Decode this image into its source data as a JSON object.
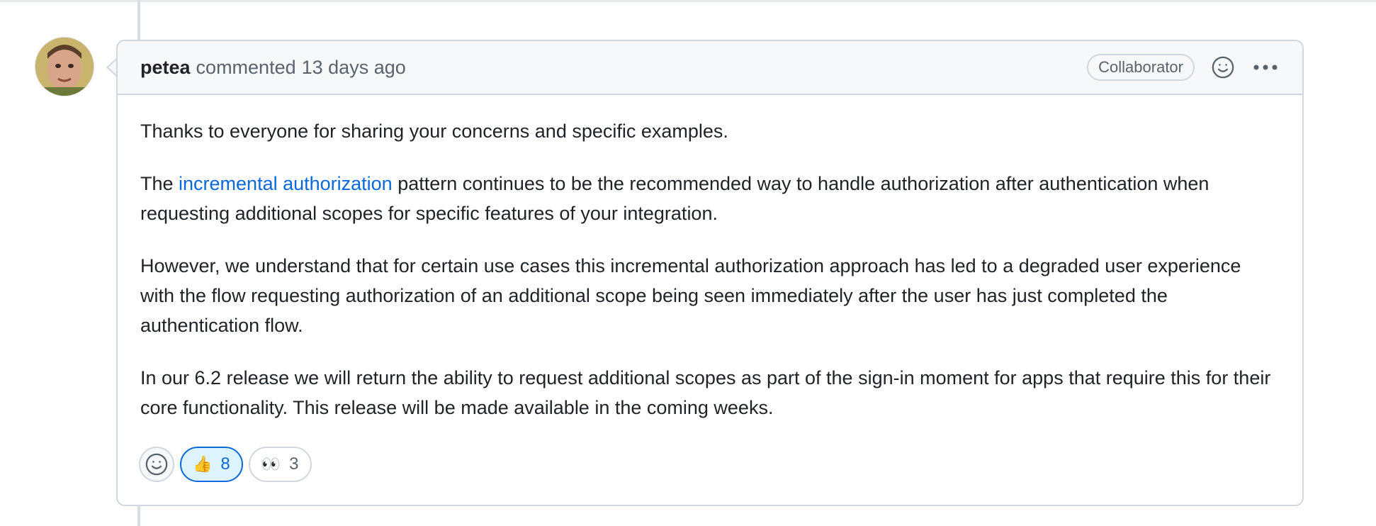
{
  "comment": {
    "author": "petea",
    "action": "commented",
    "timestamp": "13 days ago",
    "role_badge": "Collaborator",
    "paragraphs": {
      "p1": "Thanks to everyone for sharing your concerns and specific examples.",
      "p2_before": "The ",
      "p2_link": "incremental authorization",
      "p2_after": " pattern continues to be the recommended way to handle authorization after authentication when requesting additional scopes for specific features of your integration.",
      "p3": "However, we understand that for certain use cases this incremental authorization approach has led to a degraded user experience with the flow requesting authorization of an additional scope being seen immediately after the user has just completed the authentication flow.",
      "p4": "In our 6.2 release we will return the ability to request additional scopes as part of the sign-in moment for apps that require this for their core functionality. This release will be made available in the coming weeks."
    }
  },
  "reactions": [
    {
      "emoji": "👍",
      "count": "8",
      "active": true
    },
    {
      "emoji": "👀",
      "count": "3",
      "active": false
    }
  ],
  "icons": {
    "header_emoji": "smiley-icon",
    "header_menu": "kebab-horizontal-icon",
    "add_reaction": "smiley-icon"
  },
  "colors": {
    "link": "#0969da",
    "border": "#d0d7de",
    "header_bg": "#f6f8fa",
    "active_reaction_bg": "#ddf4ff"
  }
}
